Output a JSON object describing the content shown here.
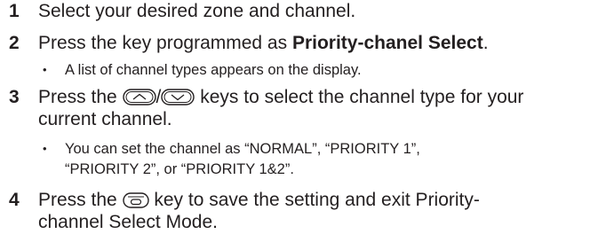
{
  "steps": [
    {
      "number": "1",
      "text": "Select your desired zone and channel."
    },
    {
      "number": "2",
      "text_before": "Press the key programmed as ",
      "text_bold": "Priority-chanel Select",
      "text_after": ".",
      "sub": {
        "bullet": "•",
        "text": "A list of channel types appears on the display."
      }
    },
    {
      "number": "3",
      "text_before": "Press the ",
      "separator": "/",
      "text_after_line1": " keys to select the channel type for your",
      "text_line2": "current channel.",
      "icons": [
        "up-key-icon",
        "down-key-icon"
      ],
      "sub": {
        "bullet": "•",
        "text_line1": "You can set the channel as “NORMAL”, “PRIORITY 1”,",
        "text_line2": "“PRIORITY 2”, or “PRIORITY 1&2”."
      }
    },
    {
      "number": "4",
      "text_before": "Press the ",
      "text_after_line1": " key to save the setting and exit Priority-",
      "text_line2": "channel Select Mode.",
      "icons": [
        "ok-key-icon"
      ]
    }
  ],
  "colors": {
    "text": "#231f20",
    "background": "#ffffff"
  }
}
